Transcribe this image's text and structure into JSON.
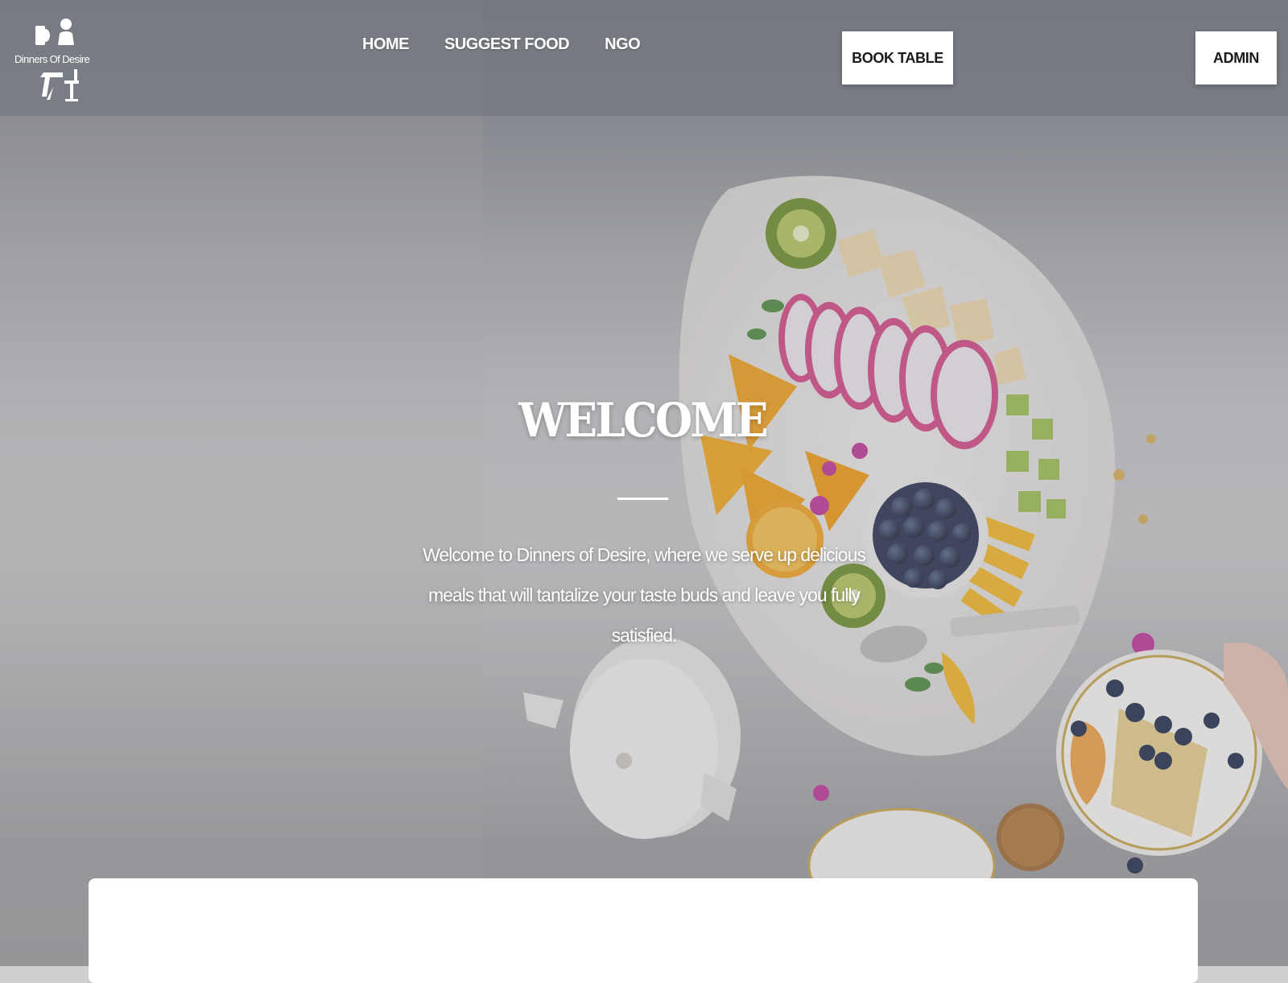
{
  "brand": {
    "name": "Dinners Of Desire",
    "logo_icon": "restaurant-diners-icon"
  },
  "nav": {
    "items": [
      {
        "label": "HOME"
      },
      {
        "label": "SUGGEST FOOD"
      },
      {
        "label": "NGO"
      }
    ]
  },
  "actions": {
    "book_label": "BOOK TABLE",
    "admin_label": "ADMIN"
  },
  "hero": {
    "title": "WELCOME",
    "text": "Welcome to Dinners of Desire, where we serve up delicious meals that will tantalize your taste buds and leave you fully satisfied.",
    "image_subject": "fruit platter with blueberries, dragon fruit, oranges, kiwi, teapot and pancakes"
  },
  "colors": {
    "header_bg": "#6e727a",
    "button_bg": "#ffffff",
    "text_light": "#ffffff"
  }
}
